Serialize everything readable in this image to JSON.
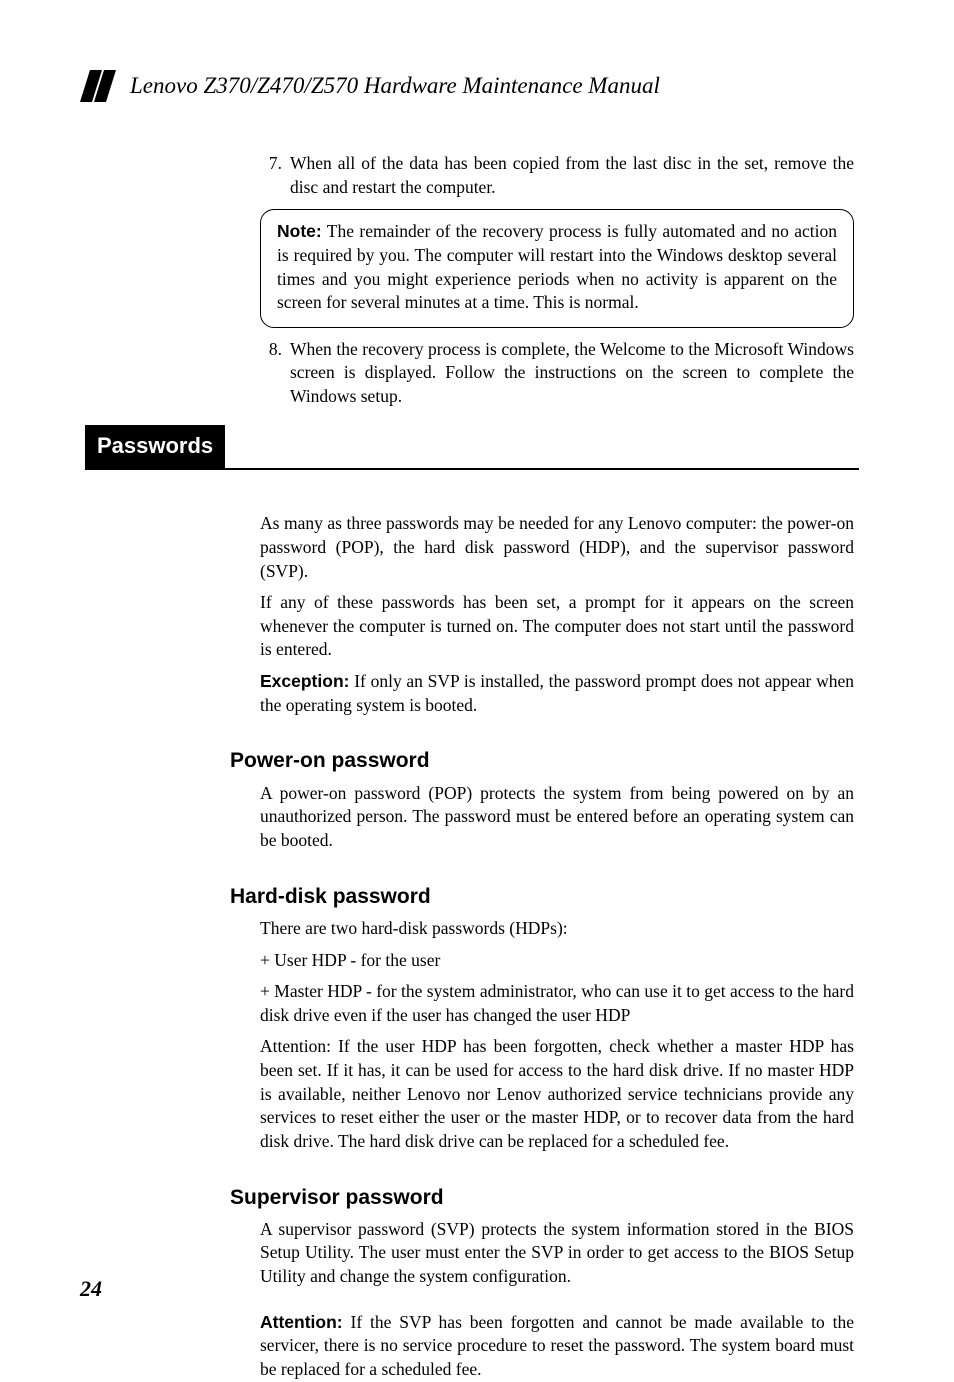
{
  "header": {
    "title": "Lenovo Z370/Z470/Z570 Hardware Maintenance Manual"
  },
  "steps": {
    "s7": {
      "num": "7.",
      "text": "When all of the data has been copied from the last disc in the set, remove the disc and restart the computer."
    },
    "note": {
      "label": "Note:",
      "text": " The remainder of the recovery process is fully automated and no action is required by you. The computer will restart into the Windows desktop several times and you might experience periods when no activity is apparent on the screen for several minutes at a time. This is normal."
    },
    "s8": {
      "num": "8.",
      "text": "When the recovery process is complete, the Welcome to the Microsoft Windows screen is displayed. Follow the instructions on the screen to complete the Windows setup."
    }
  },
  "section": {
    "title": "Passwords",
    "intro1": "As many as three passwords may be needed for any Lenovo computer: the power-on password (POP), the hard disk password (HDP), and the supervisor password (SVP).",
    "intro2": "If any of these passwords has been set, a prompt for it appears on the screen whenever the computer is turned on. The computer does not start until the password is entered.",
    "exception_label": "Exception:",
    "exception_text": " If only an SVP is installed, the password prompt does not appear when the operating system is booted."
  },
  "pop": {
    "heading": "Power-on password",
    "text": "A power-on password (POP) protects the system from being powered on by an unauthorized person. The password must be entered before an operating system can be booted."
  },
  "hdp": {
    "heading": "Hard-disk password",
    "p1": "There are two hard-disk passwords (HDPs):",
    "p2": "+ User HDP - for the user",
    "p3": "+ Master HDP - for the system administrator, who can use it to get access to the hard disk drive even if the user has changed the user HDP",
    "p4": "Attention: If the user HDP has been forgotten, check whether a master HDP has been set. If it has, it can be used for access to the hard disk drive. If no master HDP is available, neither Lenovo nor Lenov authorized service technicians provide any services to reset either the user or the master HDP, or to recover data from the hard disk drive. The hard disk drive can be replaced for a scheduled fee."
  },
  "svp": {
    "heading": "Supervisor password",
    "p1": "A supervisor password (SVP) protects the system information stored in the BIOS Setup Utility. The user must enter the SVP in order to get access to the BIOS Setup Utility and change the system configuration.",
    "attn_label": "Attention:",
    "attn_text": " If the SVP has been forgotten and cannot be made available to the servicer, there is no service procedure to reset the password. The system board must be replaced for a scheduled fee."
  },
  "page_number": "24"
}
